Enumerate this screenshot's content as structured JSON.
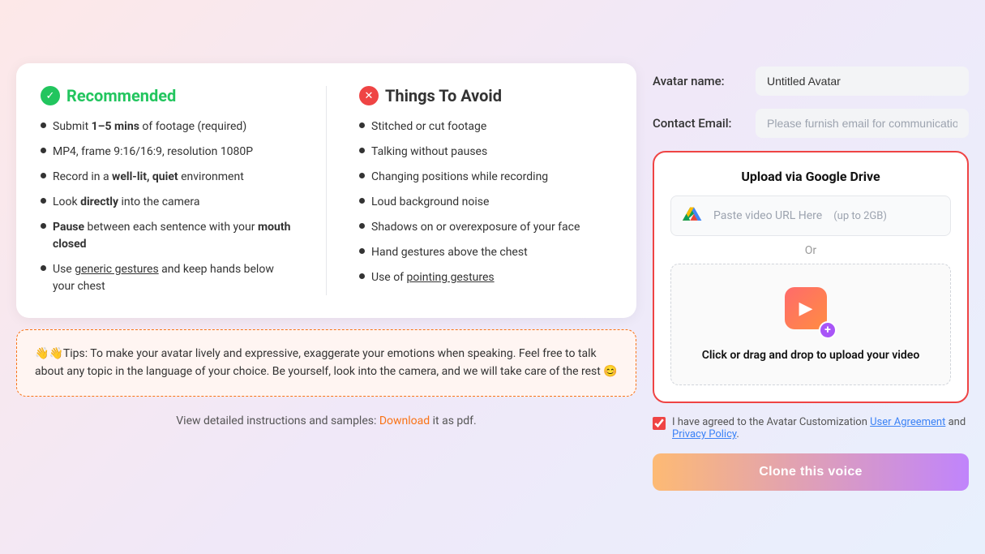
{
  "recommended": {
    "title": "Recommended",
    "items": [
      {
        "text_before": "Submit ",
        "bold": "1–5 mins",
        "text_after": " of footage (required)"
      },
      {
        "text_before": "MP4, frame 9:16/16:9, resolution 1080P"
      },
      {
        "text_before": "Record in a ",
        "bold": "well-lit, quiet",
        "text_after": " environment"
      },
      {
        "text_before": "Look ",
        "bold": "directly",
        "text_after": " into the camera"
      },
      {
        "text_before": "",
        "bold": "Pause",
        "text_after": " between each sentence with your ",
        "bold2": "mouth closed"
      },
      {
        "text_before": "Use ",
        "underline": "generic gestures",
        "text_after": " and keep hands below your chest"
      }
    ]
  },
  "avoid": {
    "title": "Things To Avoid",
    "items": [
      {
        "text": "Stitched or cut footage"
      },
      {
        "text": "Talking without pauses"
      },
      {
        "text": "Changing positions while recording"
      },
      {
        "text": "Loud background noise"
      },
      {
        "text": "Shadows on or overexposure of your face"
      },
      {
        "text": "Hand gestures above the chest"
      },
      {
        "text_before": "Use of ",
        "underline": "pointing gestures"
      }
    ]
  },
  "tips": {
    "emoji1": "👋",
    "emoji2": "👋",
    "text": "Tips: To make your avatar lively and expressive, exaggerate your emotions when speaking. Feel free to talk about any topic in the language of your choice. Be yourself, look into the camera, and we will take care of the rest 😊"
  },
  "footer": {
    "text_before": "View detailed instructions and samples: ",
    "link_text": "Download",
    "text_after": " it as pdf."
  },
  "form": {
    "avatar_name_label": "Avatar name:",
    "avatar_name_value": "Untitled Avatar",
    "contact_email_label": "Contact Email:",
    "contact_email_placeholder": "Please furnish email for communication."
  },
  "upload": {
    "title": "Upload via Google Drive",
    "gdrive_placeholder": "Paste video URL Here",
    "gdrive_limit": "(up to 2GB)",
    "or_text": "Or",
    "drop_label": "Click or drag and drop to upload your video"
  },
  "agreement": {
    "text_before": "I have agreed to the Avatar Customization  ",
    "user_agreement": "User Agreement",
    "and_text": " and ",
    "privacy_policy": "Privacy Policy",
    "period": "."
  },
  "clone_btn": "Clone this voice"
}
